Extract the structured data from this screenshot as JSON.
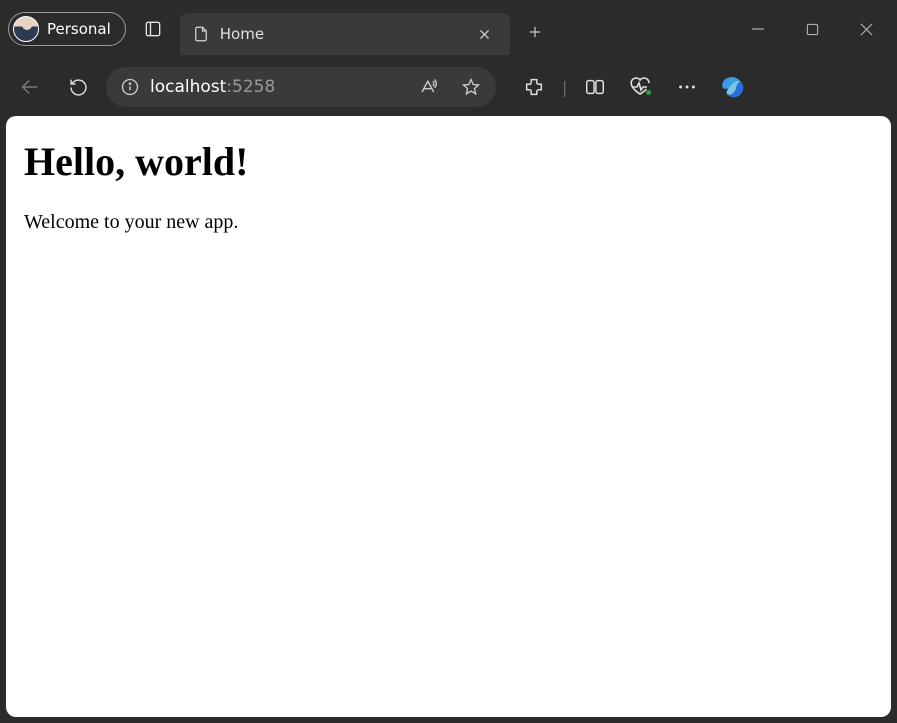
{
  "profile": {
    "label": "Personal"
  },
  "tab": {
    "title": "Home"
  },
  "url": {
    "host": "localhost",
    "port": ":5258"
  },
  "page": {
    "heading": "Hello, world!",
    "body": "Welcome to your new app."
  }
}
